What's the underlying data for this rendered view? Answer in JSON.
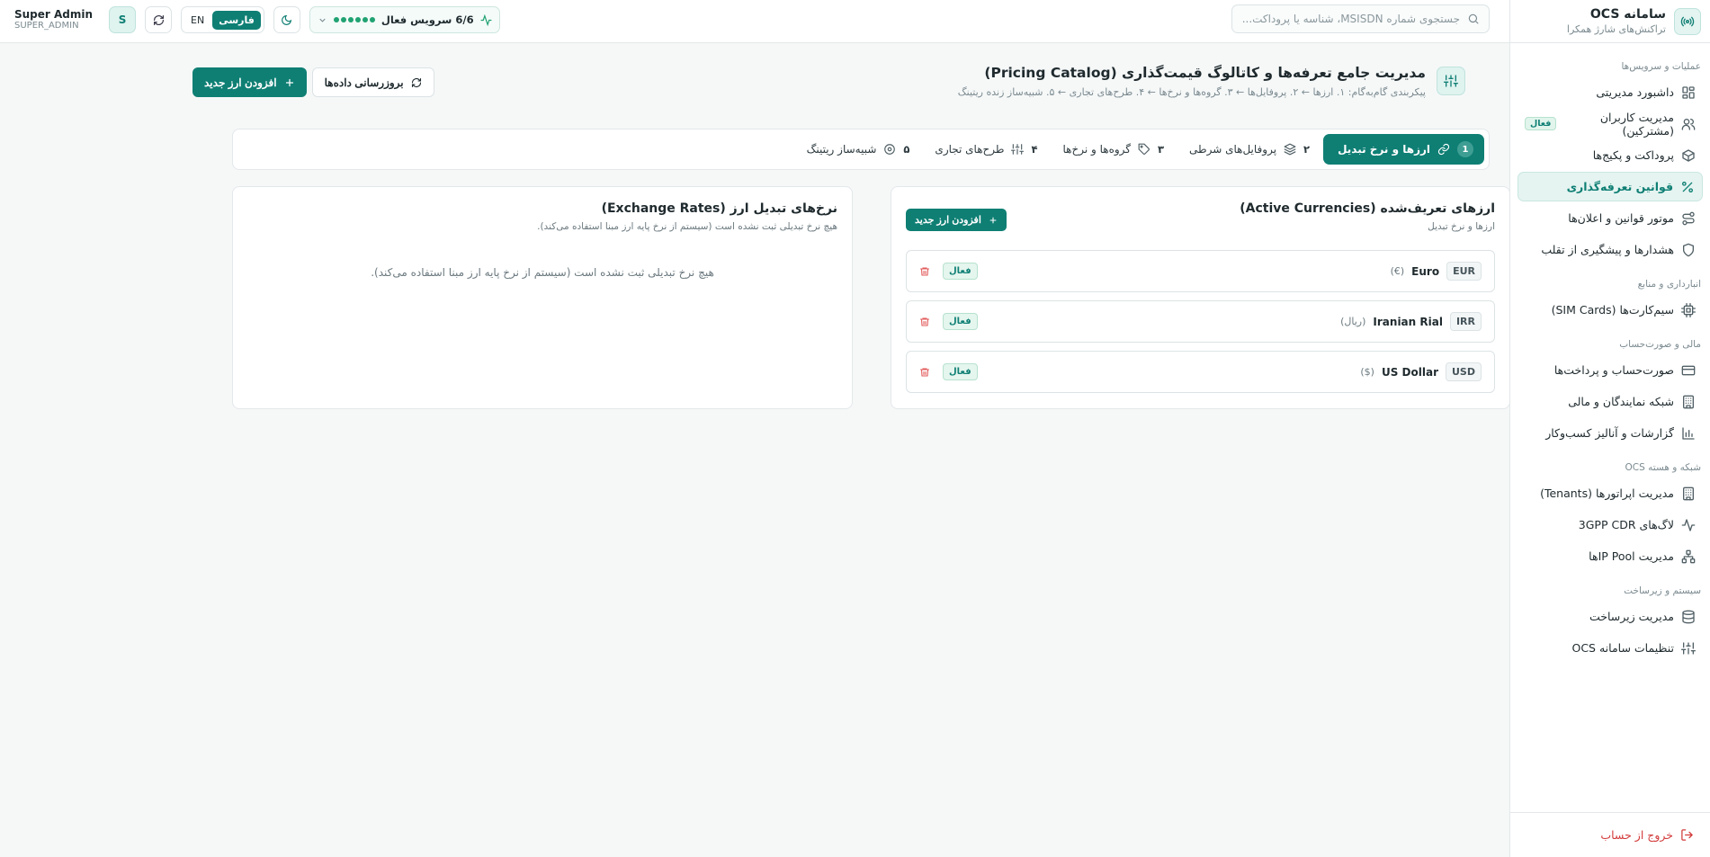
{
  "brand": {
    "title": "سامانه OCS",
    "subtitle": "تراکنش‌های شارژ همکرا"
  },
  "sidebar": {
    "sections": [
      {
        "title": "عملیات و سرویس‌ها",
        "items": [
          {
            "label": "داشبورد مدیریتی",
            "icon": "dashboard-icon"
          },
          {
            "label": "مدیریت کاربران (مشترکین)",
            "icon": "users-icon",
            "badge": "فعال"
          },
          {
            "label": "پروداکت و پکیج‌ها",
            "icon": "box-icon"
          },
          {
            "label": "قوانین تعرفه‌گذاری",
            "icon": "percent-icon",
            "active": true
          },
          {
            "label": "موتور قوانین و اعلان‌ها",
            "icon": "route-icon"
          },
          {
            "label": "هشدارها و پیشگیری از تقلب",
            "icon": "shield-icon"
          }
        ]
      },
      {
        "title": "انبارداری و منابع",
        "items": [
          {
            "label": "سیم‌کارت‌ها (SIM Cards)",
            "icon": "cpu-icon"
          }
        ]
      },
      {
        "title": "مالی و صورت‌حساب",
        "items": [
          {
            "label": "صورت‌حساب و پرداخت‌ها",
            "icon": "card-icon"
          },
          {
            "label": "شبکه نمایندگان و مالی",
            "icon": "building-icon"
          },
          {
            "label": "گزارشات و آنالیز کسب‌وکار",
            "icon": "bar-chart-icon"
          }
        ]
      },
      {
        "title": "شبکه و هسته OCS",
        "items": [
          {
            "label": "مدیریت اپراتورها (Tenants)",
            "icon": "building-icon"
          },
          {
            "label": "لاگ‌های 3GPP CDR",
            "icon": "activity-icon"
          },
          {
            "label": "مدیریت IP Poolها",
            "icon": "network-icon"
          }
        ]
      },
      {
        "title": "سیستم و زیرساخت",
        "items": [
          {
            "label": "مدیریت زیرساخت",
            "icon": "database-icon"
          },
          {
            "label": "تنظیمات سامانه OCS",
            "icon": "sliders-icon"
          }
        ]
      }
    ],
    "logout": "خروج از حساب"
  },
  "header": {
    "search_placeholder": "جستجوی شماره MSISDN، شناسه یا پروداکت...",
    "services": "6/6 سرویس فعال",
    "lang_fa": "فارسی",
    "lang_en": "EN",
    "admin_name": "Super Admin",
    "admin_role": "SUPER_ADMIN",
    "avatar": "S"
  },
  "page": {
    "title": "مدیریت جامع تعرفه‌ها و کاتالوگ قیمت‌گذاری (Pricing Catalog)",
    "subtitle": "پیکربندی گام‌به‌گام: ۱. ارزها ← ۲. پروفایل‌ها ← ۳. گروه‌ها و نرخ‌ها ← ۴. طرح‌های تجاری ← ۵. شبیه‌ساز زنده ریتینگ",
    "refresh_button": "بروزرسانی داده‌ها",
    "add_button": "افزودن ارز جدید"
  },
  "tabs": [
    {
      "num": "1",
      "label": "ارزها و نرخ تبدیل",
      "icon": "link-icon",
      "active": true
    },
    {
      "num": "۲",
      "label": "پروفایل‌های شرطی",
      "icon": "layers-icon"
    },
    {
      "num": "۳",
      "label": "گروه‌ها و نرخ‌ها",
      "icon": "tag-icon"
    },
    {
      "num": "۴",
      "label": "طرح‌های تجاری",
      "icon": "sliders-icon"
    },
    {
      "num": "۵",
      "label": "شبیه‌ساز ریتینگ",
      "icon": "target-icon"
    }
  ],
  "currencies": {
    "title": "ارزهای تعریف‌شده (Active Currencies)",
    "subtitle": "ارزها و نرخ تبدیل",
    "add_button": "افزودن ارز جدید",
    "rows": [
      {
        "code": "EUR",
        "name": "Euro",
        "symbol": "(€)",
        "status": "فعال"
      },
      {
        "code": "IRR",
        "name": "Iranian Rial",
        "symbol": "(ریال)",
        "status": "فعال"
      },
      {
        "code": "USD",
        "name": "US Dollar",
        "symbol": "($)",
        "status": "فعال"
      }
    ]
  },
  "rates": {
    "title": "نرخ‌های تبدیل ارز (Exchange Rates)",
    "subtitle": "هیچ نرخ تبدیلی ثبت نشده است (سیستم از نرخ پایه ارز مبنا استفاده می‌کند).",
    "empty": "هیچ نرخ تبدیلی ثبت نشده است (سیستم از نرخ پایه ارز مبنا استفاده می‌کند)."
  }
}
